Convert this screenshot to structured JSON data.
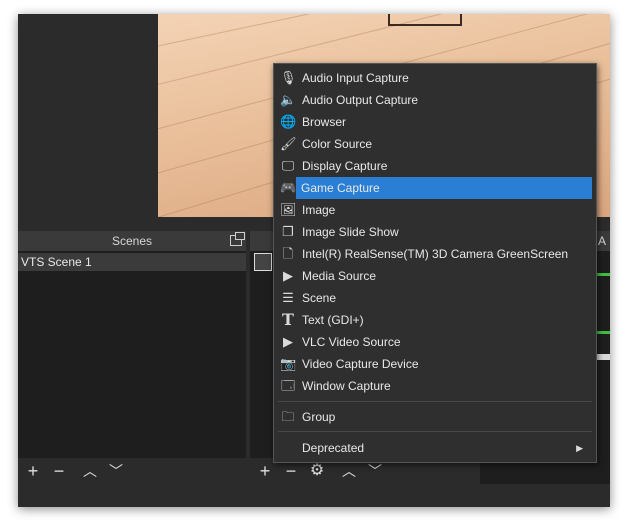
{
  "scenes_dock": {
    "title": "Scenes",
    "items": [
      "VTS Scene 1"
    ],
    "toolbar": {
      "add": "+",
      "remove": "−",
      "up": "︿",
      "down": "﹀"
    }
  },
  "sources_dock": {
    "toolbar": {
      "add": "+",
      "remove": "−",
      "settings": "⚙",
      "up": "︿",
      "down": "﹀"
    }
  },
  "audio_dock": {
    "title_fragment": "A"
  },
  "context_menu": {
    "items": [
      {
        "label": "Audio Input Capture",
        "icon": "microphone-icon"
      },
      {
        "label": "Audio Output Capture",
        "icon": "speaker-icon"
      },
      {
        "label": "Browser",
        "icon": "globe-icon"
      },
      {
        "label": "Color Source",
        "icon": "paintbrush-icon"
      },
      {
        "label": "Display Capture",
        "icon": "monitor-icon"
      },
      {
        "label": "Game Capture",
        "icon": "gamepad-icon",
        "highlighted": true
      },
      {
        "label": "Image",
        "icon": "image-icon"
      },
      {
        "label": "Image Slide Show",
        "icon": "slideshow-icon"
      },
      {
        "label": "Intel(R) RealSense(TM) 3D Camera GreenScreen",
        "icon": "file-icon"
      },
      {
        "label": "Media Source",
        "icon": "play-icon"
      },
      {
        "label": "Scene",
        "icon": "list-icon"
      },
      {
        "label": "Text (GDI+)",
        "icon": "text-icon"
      },
      {
        "label": "VLC Video Source",
        "icon": "play-icon"
      },
      {
        "label": "Video Capture Device",
        "icon": "camera-icon"
      },
      {
        "label": "Window Capture",
        "icon": "window-icon"
      },
      {
        "label": "Group",
        "icon": "folder-icon"
      },
      {
        "label": "Deprecated",
        "icon": "",
        "submenu": true
      }
    ],
    "highlight_color": "#2a7fd4"
  }
}
